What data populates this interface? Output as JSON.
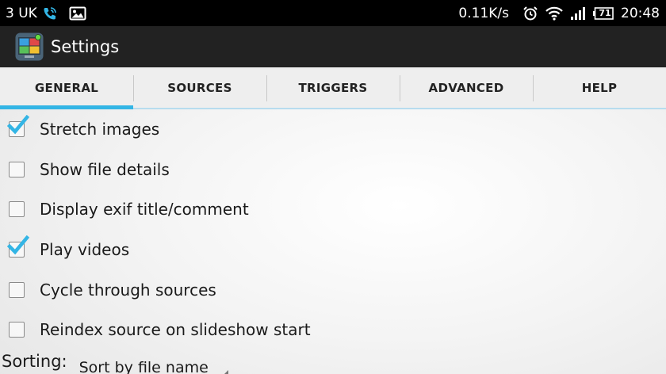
{
  "status_bar": {
    "carrier": "3 UK",
    "data_speed": "0.11K/s",
    "battery_level": "71",
    "time": "20:48",
    "icons": [
      "phone-call-icon",
      "image-notification-icon",
      "alarm-clock-icon",
      "wifi-icon",
      "signal-bars-icon",
      "battery-icon"
    ]
  },
  "action_bar": {
    "title": "Settings",
    "icon": "slideshow-app-icon"
  },
  "tabs": [
    {
      "label": "GENERAL",
      "active": true
    },
    {
      "label": "SOURCES",
      "active": false
    },
    {
      "label": "TRIGGERS",
      "active": false
    },
    {
      "label": "ADVANCED",
      "active": false
    },
    {
      "label": "HELP",
      "active": false
    }
  ],
  "settings": [
    {
      "label": "Stretch images",
      "checked": true
    },
    {
      "label": "Show file details",
      "checked": false
    },
    {
      "label": "Display exif title/comment",
      "checked": false
    },
    {
      "label": "Play videos",
      "checked": true
    },
    {
      "label": "Cycle through sources",
      "checked": false
    },
    {
      "label": "Reindex source on slideshow start",
      "checked": false
    }
  ],
  "sorting": {
    "label": "Sorting:",
    "selected": "Sort by file name"
  },
  "colors": {
    "accent": "#33b5e5",
    "action_bar": "#222222",
    "status_bar": "#000000",
    "tab_background": "#eeeeee"
  }
}
